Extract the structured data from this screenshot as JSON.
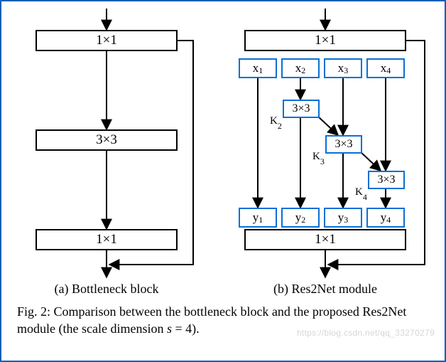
{
  "caption_prefix": "Fig. 2: Comparison between the bottleneck block and the proposed Res2Net module (the scale dimension ",
  "caption_var": "s",
  "caption_eq": " = 4).",
  "subcaption_a": "(a) Bottleneck block",
  "subcaption_b": "(b) Res2Net module",
  "conv1x1": "1×1",
  "conv3x3": "3×3",
  "x_base": "x",
  "y_base": "y",
  "idx1": "1",
  "idx2": "2",
  "idx3": "3",
  "idx4": "4",
  "k2": "K",
  "k3": "K",
  "k4": "K",
  "watermark": "https://blog.csdn.net/qq_33270279",
  "chart_data": {
    "type": "diagram",
    "panels": [
      {
        "id": "a",
        "title": "Bottleneck block",
        "nodes": [
          {
            "id": "in",
            "type": "input"
          },
          {
            "id": "c1",
            "type": "conv",
            "kernel": "1x1"
          },
          {
            "id": "c2",
            "type": "conv",
            "kernel": "3x3"
          },
          {
            "id": "c3",
            "type": "conv",
            "kernel": "1x1"
          },
          {
            "id": "out",
            "type": "output"
          }
        ],
        "edges": [
          [
            "in",
            "c1"
          ],
          [
            "c1",
            "c2"
          ],
          [
            "c2",
            "c3"
          ],
          [
            "c3",
            "out"
          ],
          [
            "c1",
            "out",
            "residual"
          ]
        ]
      },
      {
        "id": "b",
        "title": "Res2Net module",
        "scale_s": 4,
        "nodes": [
          {
            "id": "in",
            "type": "input"
          },
          {
            "id": "c1",
            "type": "conv",
            "kernel": "1x1"
          },
          {
            "id": "x1",
            "type": "split"
          },
          {
            "id": "x2",
            "type": "split"
          },
          {
            "id": "x3",
            "type": "split"
          },
          {
            "id": "x4",
            "type": "split"
          },
          {
            "id": "K2",
            "type": "conv",
            "kernel": "3x3"
          },
          {
            "id": "K3",
            "type": "conv",
            "kernel": "3x3"
          },
          {
            "id": "K4",
            "type": "conv",
            "kernel": "3x3"
          },
          {
            "id": "y1",
            "type": "concat-slot"
          },
          {
            "id": "y2",
            "type": "concat-slot"
          },
          {
            "id": "y3",
            "type": "concat-slot"
          },
          {
            "id": "y4",
            "type": "concat-slot"
          },
          {
            "id": "c2",
            "type": "conv",
            "kernel": "1x1"
          },
          {
            "id": "out",
            "type": "output"
          }
        ],
        "edges": [
          [
            "in",
            "c1"
          ],
          [
            "c1",
            "x1"
          ],
          [
            "c1",
            "x2"
          ],
          [
            "c1",
            "x3"
          ],
          [
            "c1",
            "x4"
          ],
          [
            "x1",
            "y1"
          ],
          [
            "x2",
            "K2"
          ],
          [
            "K2",
            "y2"
          ],
          [
            "K2",
            "K3"
          ],
          [
            "x3",
            "K3"
          ],
          [
            "K3",
            "y3"
          ],
          [
            "K3",
            "K4"
          ],
          [
            "x4",
            "K4"
          ],
          [
            "K4",
            "y4"
          ],
          [
            "y1",
            "c2"
          ],
          [
            "y2",
            "c2"
          ],
          [
            "y3",
            "c2"
          ],
          [
            "y4",
            "c2"
          ],
          [
            "c2",
            "out"
          ],
          [
            "c1",
            "out",
            "residual"
          ]
        ]
      }
    ]
  }
}
